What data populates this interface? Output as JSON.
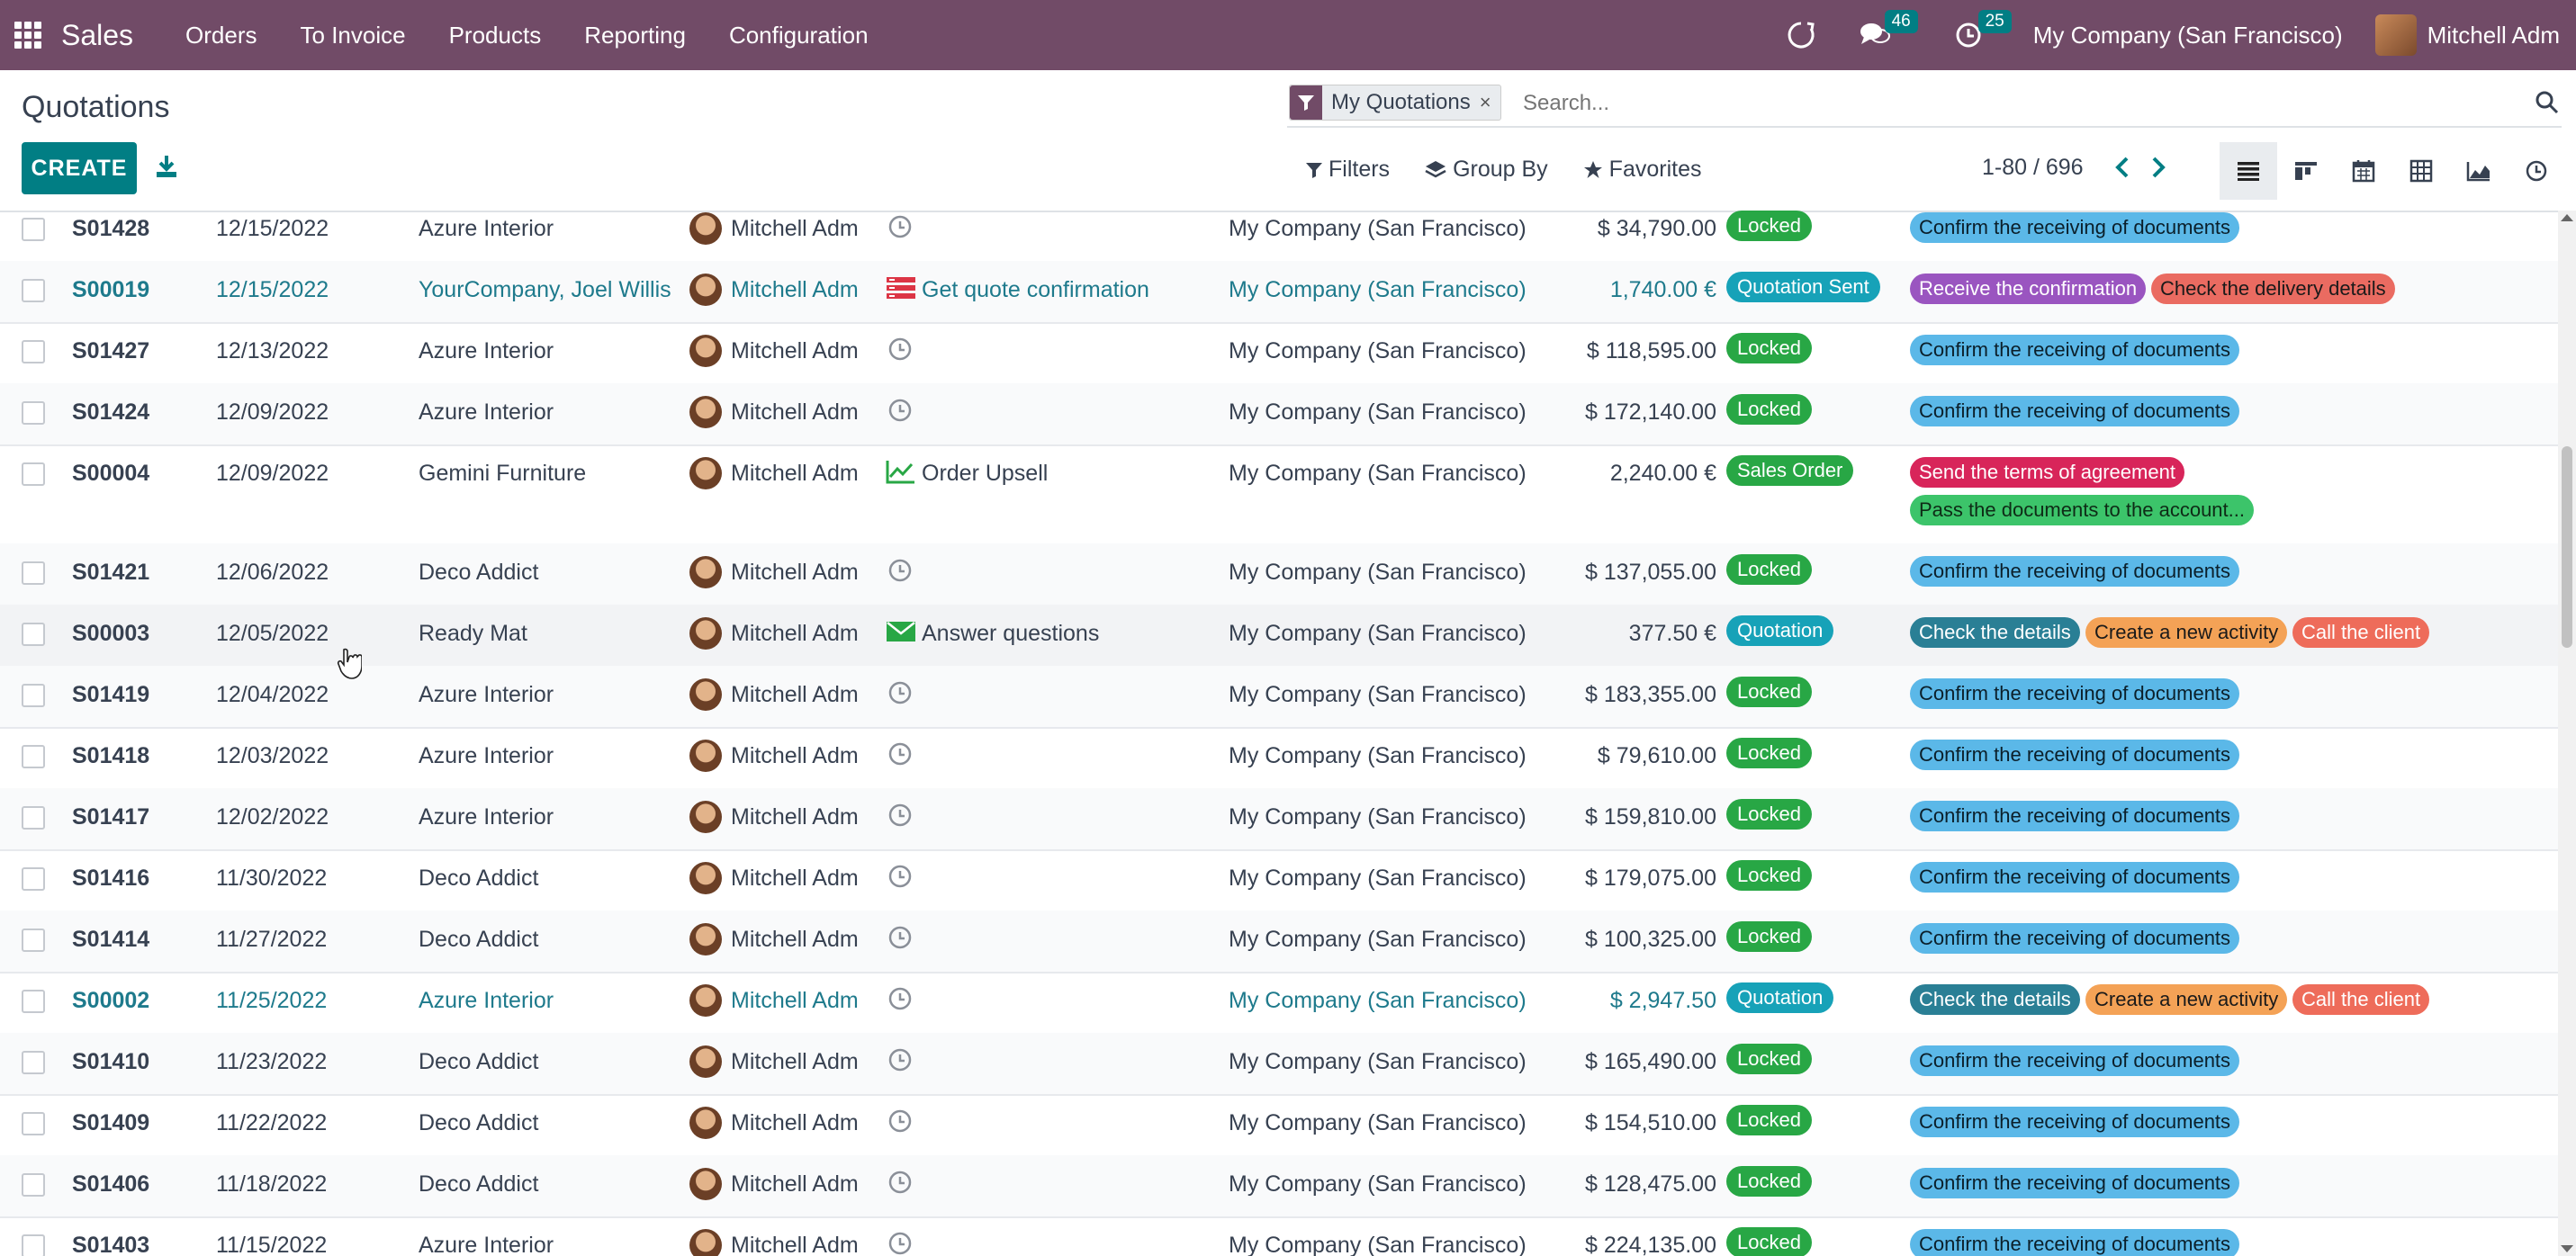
{
  "navbar": {
    "app_name": "Sales",
    "menu": [
      "Orders",
      "To Invoice",
      "Products",
      "Reporting",
      "Configuration"
    ],
    "messages_count": "46",
    "activities_count": "25",
    "company": "My Company (San Francisco)",
    "user": "Mitchell Adm"
  },
  "control": {
    "title": "Quotations",
    "create_label": "CREATE",
    "facet_label": "My Quotations",
    "facet_close": "×",
    "search_placeholder": "Search...",
    "filters_label": "Filters",
    "groupby_label": "Group By",
    "favorites_label": "Favorites",
    "pager": "1-80 / 696"
  },
  "colors": {
    "brand": "#714b67",
    "primary": "#017e84",
    "link": "#1e7a8c"
  },
  "rows": [
    {
      "number": "S01428",
      "date": "12/15/2022",
      "customer": "Azure Interior",
      "salesperson": "Mitchell Adm",
      "activity": "",
      "activity_icon": "clock-icon",
      "company": "My Company (San Francisco)",
      "total": "$ 34,790.00",
      "status": "Locked",
      "tags": [
        {
          "label": "Confirm the receiving of documents",
          "color": "blue"
        }
      ]
    },
    {
      "number": "S00019",
      "date": "12/15/2022",
      "customer": "YourCompany, Joel Willis",
      "salesperson": "Mitchell Adm",
      "activity": "Get quote confirmation",
      "activity_icon": "list-icon",
      "company": "My Company (San Francisco)",
      "total": "1,740.00 €",
      "status": "Quotation Sent",
      "link": true,
      "tags": [
        {
          "label": "Receive the confirmation",
          "color": "purple"
        },
        {
          "label": "Check the delivery details",
          "color": "coral"
        }
      ]
    },
    {
      "number": "S01427",
      "date": "12/13/2022",
      "customer": "Azure Interior",
      "salesperson": "Mitchell Adm",
      "activity": "",
      "activity_icon": "clock-icon",
      "company": "My Company (San Francisco)",
      "total": "$ 118,595.00",
      "status": "Locked",
      "tags": [
        {
          "label": "Confirm the receiving of documents",
          "color": "blue"
        }
      ]
    },
    {
      "number": "S01424",
      "date": "12/09/2022",
      "customer": "Azure Interior",
      "salesperson": "Mitchell Adm",
      "activity": "",
      "activity_icon": "clock-icon",
      "company": "My Company (San Francisco)",
      "total": "$ 172,140.00",
      "status": "Locked",
      "tags": [
        {
          "label": "Confirm the receiving of documents",
          "color": "blue"
        }
      ]
    },
    {
      "number": "S00004",
      "date": "12/09/2022",
      "customer": "Gemini Furniture",
      "salesperson": "Mitchell Adm",
      "activity": "Order Upsell",
      "activity_icon": "chart-icon",
      "company": "My Company (San Francisco)",
      "total": "2,240.00 €",
      "status": "Sales Order",
      "tall": true,
      "tags": [
        {
          "label": "Send the terms of agreement",
          "color": "red"
        },
        {
          "label": "Pass the documents to the account...",
          "color": "green"
        }
      ]
    },
    {
      "number": "S01421",
      "date": "12/06/2022",
      "customer": "Deco Addict",
      "salesperson": "Mitchell Adm",
      "activity": "",
      "activity_icon": "clock-icon",
      "company": "My Company (San Francisco)",
      "total": "$ 137,055.00",
      "status": "Locked",
      "tags": [
        {
          "label": "Confirm the receiving of documents",
          "color": "blue"
        }
      ]
    },
    {
      "number": "S00003",
      "date": "12/05/2022",
      "customer": "Ready Mat",
      "salesperson": "Mitchell Adm",
      "activity": "Answer questions",
      "activity_icon": "envelope-icon",
      "company": "My Company (San Francisco)",
      "total": "377.50 €",
      "status": "Quotation",
      "hl": true,
      "tags": [
        {
          "label": "Check the details",
          "color": "teal"
        },
        {
          "label": "Create a new activity",
          "color": "orange"
        },
        {
          "label": "Call the client",
          "color": "salmon"
        }
      ]
    },
    {
      "number": "S01419",
      "date": "12/04/2022",
      "customer": "Azure Interior",
      "salesperson": "Mitchell Adm",
      "activity": "",
      "activity_icon": "clock-icon",
      "company": "My Company (San Francisco)",
      "total": "$ 183,355.00",
      "status": "Locked",
      "tags": [
        {
          "label": "Confirm the receiving of documents",
          "color": "blue"
        }
      ]
    },
    {
      "number": "S01418",
      "date": "12/03/2022",
      "customer": "Azure Interior",
      "salesperson": "Mitchell Adm",
      "activity": "",
      "activity_icon": "clock-icon",
      "company": "My Company (San Francisco)",
      "total": "$ 79,610.00",
      "status": "Locked",
      "tags": [
        {
          "label": "Confirm the receiving of documents",
          "color": "blue"
        }
      ]
    },
    {
      "number": "S01417",
      "date": "12/02/2022",
      "customer": "Azure Interior",
      "salesperson": "Mitchell Adm",
      "activity": "",
      "activity_icon": "clock-icon",
      "company": "My Company (San Francisco)",
      "total": "$ 159,810.00",
      "status": "Locked",
      "tags": [
        {
          "label": "Confirm the receiving of documents",
          "color": "blue"
        }
      ]
    },
    {
      "number": "S01416",
      "date": "11/30/2022",
      "customer": "Deco Addict",
      "salesperson": "Mitchell Adm",
      "activity": "",
      "activity_icon": "clock-icon",
      "company": "My Company (San Francisco)",
      "total": "$ 179,075.00",
      "status": "Locked",
      "tags": [
        {
          "label": "Confirm the receiving of documents",
          "color": "blue"
        }
      ]
    },
    {
      "number": "S01414",
      "date": "11/27/2022",
      "customer": "Deco Addict",
      "salesperson": "Mitchell Adm",
      "activity": "",
      "activity_icon": "clock-icon",
      "company": "My Company (San Francisco)",
      "total": "$ 100,325.00",
      "status": "Locked",
      "tags": [
        {
          "label": "Confirm the receiving of documents",
          "color": "blue"
        }
      ]
    },
    {
      "number": "S00002",
      "date": "11/25/2022",
      "customer": "Azure Interior",
      "salesperson": "Mitchell Adm",
      "activity": "",
      "activity_icon": "clock-icon",
      "company": "My Company (San Francisco)",
      "total": "$ 2,947.50",
      "status": "Quotation",
      "link": true,
      "tags": [
        {
          "label": "Check the details",
          "color": "teal"
        },
        {
          "label": "Create a new activity",
          "color": "orange"
        },
        {
          "label": "Call the client",
          "color": "salmon"
        }
      ]
    },
    {
      "number": "S01410",
      "date": "11/23/2022",
      "customer": "Deco Addict",
      "salesperson": "Mitchell Adm",
      "activity": "",
      "activity_icon": "clock-icon",
      "company": "My Company (San Francisco)",
      "total": "$ 165,490.00",
      "status": "Locked",
      "tags": [
        {
          "label": "Confirm the receiving of documents",
          "color": "blue"
        }
      ]
    },
    {
      "number": "S01409",
      "date": "11/22/2022",
      "customer": "Deco Addict",
      "salesperson": "Mitchell Adm",
      "activity": "",
      "activity_icon": "clock-icon",
      "company": "My Company (San Francisco)",
      "total": "$ 154,510.00",
      "status": "Locked",
      "tags": [
        {
          "label": "Confirm the receiving of documents",
          "color": "blue"
        }
      ]
    },
    {
      "number": "S01406",
      "date": "11/18/2022",
      "customer": "Deco Addict",
      "salesperson": "Mitchell Adm",
      "activity": "",
      "activity_icon": "clock-icon",
      "company": "My Company (San Francisco)",
      "total": "$ 128,475.00",
      "status": "Locked",
      "tags": [
        {
          "label": "Confirm the receiving of documents",
          "color": "blue"
        }
      ]
    },
    {
      "number": "S01403",
      "date": "11/15/2022",
      "customer": "Azure Interior",
      "salesperson": "Mitchell Adm",
      "activity": "",
      "activity_icon": "clock-icon",
      "company": "My Company (San Francisco)",
      "total": "$ 224,135.00",
      "status": "Locked",
      "tags": [
        {
          "label": "Confirm the receiving of documents",
          "color": "blue"
        }
      ]
    }
  ]
}
